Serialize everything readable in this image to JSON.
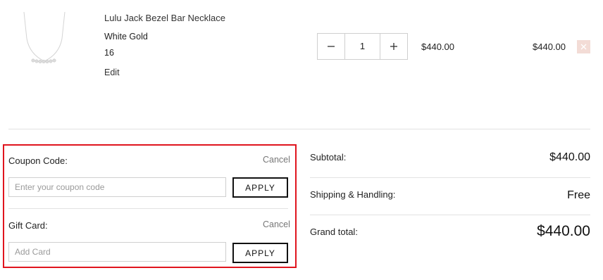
{
  "product": {
    "name": "Lulu Jack Bezel Bar Necklace",
    "metal": "White Gold",
    "size": "16",
    "edit_label": "Edit",
    "quantity": "1",
    "unit_price": "$440.00",
    "row_total": "$440.00",
    "image_icon": "necklace-thumbnail"
  },
  "coupon": {
    "label": "Coupon Code:",
    "cancel_label": "Cancel",
    "placeholder": "Enter your coupon code",
    "apply_label": "APPLY"
  },
  "gift_card": {
    "label": "Gift Card:",
    "cancel_label": "Cancel",
    "placeholder": "Add Card",
    "apply_label": "APPLY"
  },
  "totals": {
    "subtotal_label": "Subtotal:",
    "subtotal_value": "$440.00",
    "shipping_label": "Shipping & Handling:",
    "shipping_value": "Free",
    "grand_label": "Grand total:",
    "grand_value": "$440.00"
  },
  "colors": {
    "highlight_border": "#e0141e",
    "remove_bg": "#f3dcd6"
  }
}
